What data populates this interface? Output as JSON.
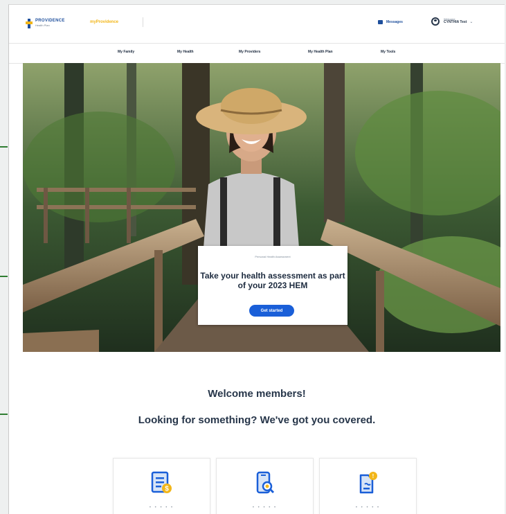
{
  "header": {
    "logo": {
      "name": "PROVIDENCE",
      "sub": "Health Plan"
    },
    "product_name": "myProvidence",
    "messages_label": "Messages",
    "account": {
      "greeting": "Welcome",
      "name": "CYNTHIA Test"
    }
  },
  "nav": {
    "items": [
      {
        "label": "My Family"
      },
      {
        "label": "My Health"
      },
      {
        "label": "My Providers"
      },
      {
        "label": "My Health Plan"
      },
      {
        "label": "My Tools"
      }
    ]
  },
  "hero": {
    "eyebrow": "Personal Health Assessment",
    "headline": "Take your health assessment as part of your 2023 HEM",
    "cta_label": "Get started"
  },
  "welcome": {
    "title": "Welcome members!",
    "subtitle": "Looking for something? We've got you covered."
  },
  "tiles": [
    {
      "icon": "bill-dollar-icon",
      "label": "• • • • •"
    },
    {
      "icon": "phone-search-icon",
      "label": "• • • • •"
    },
    {
      "icon": "document-badge-icon",
      "label": "• • • • •"
    }
  ],
  "colors": {
    "brand_blue": "#1e4f9c",
    "brand_gold": "#f2b619",
    "cta_blue": "#1a5fd8",
    "heading": "#27364a"
  }
}
